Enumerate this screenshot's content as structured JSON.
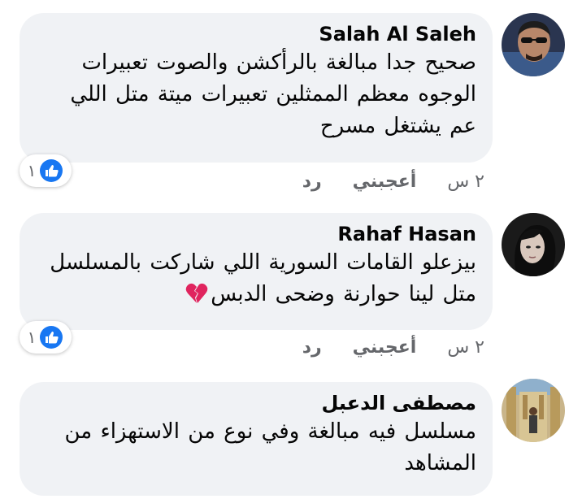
{
  "comments": [
    {
      "author": "Salah Al Saleh",
      "text_lines": [
        "صحيح جدا مبالغة بالرأكشن والصوت تعبيرات",
        "الوجوه معظم الممثلين تعبيرات ميتة متل اللي",
        "عم يشتغل مسرح"
      ],
      "time": "٢ س",
      "like_label": "أعجبني",
      "reply_label": "رد",
      "reaction_count": "١",
      "reaction_icon": "like-icon"
    },
    {
      "author": "Rahaf Hasan",
      "text_lines": [
        "بيزعلو القامات السورية اللي شاركت بالمسلسل",
        "متل لينا حوارنة وضحى الدبس"
      ],
      "emoji": "broken-heart-icon",
      "time": "٢ س",
      "like_label": "أعجبني",
      "reply_label": "رد",
      "reaction_count": "١",
      "reaction_icon": "like-icon"
    },
    {
      "author": "مصطفى الدعبل",
      "text_lines": [
        "مسلسل فيه مبالغة وفي نوع من الاستهزاء من",
        "المشاهد"
      ]
    }
  ],
  "colors": {
    "bubble": "#f0f2f5",
    "like_blue": "#1877f2",
    "meta_gray": "#65676b",
    "broken_heart": "#e0245e"
  }
}
